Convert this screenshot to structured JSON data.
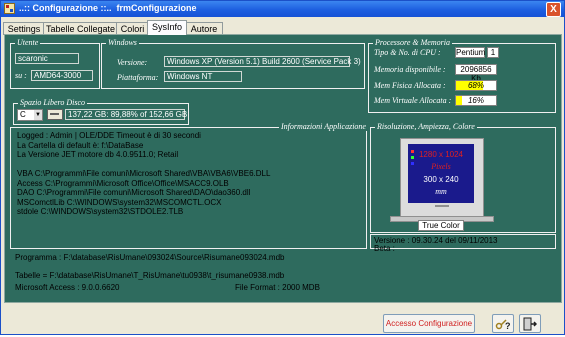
{
  "window": {
    "title": "..:: Configurazione ::..  frmConfigurazione",
    "close_label": "X"
  },
  "tabs": [
    "Settings",
    "Tabelle Collegate",
    "Colori",
    "SysInfo",
    "Autore"
  ],
  "utente": {
    "group_label": "Utente",
    "user": "scaronic",
    "su_label": "su :",
    "machine": "AMD64-3000"
  },
  "windows": {
    "group_label": "Windows",
    "version_label": "Versione:",
    "version": "Windows XP (Version 5.1) Build 2600 (Service Pack 3)",
    "platform_label": "Piattaforma:",
    "platform": "Windows NT"
  },
  "processore": {
    "group_label": "Processore & Memoria",
    "cpu_label": "Tipo  & No. di CPU :",
    "cpu_type": "Pentium",
    "cpu_count": "1",
    "mem_label": "Memoria disponibile :",
    "mem_value": "2096856 Kb",
    "phys_label": "Mem Fisica Allocata :",
    "phys_value": "68%",
    "phys_fraction": 0.68,
    "virt_label": "Mem Virtuale Allocata :",
    "virt_value": "16%",
    "virt_fraction": 0.16
  },
  "disco": {
    "group_label": "Spazio Libero Disco",
    "drive": "C",
    "info": "137,22 GB: 89,88% of 152,66 GB"
  },
  "app_info": {
    "group_label": "Informazioni Applicazione",
    "lines": [
      "Logged : Admin  |  OLE/DDE Timeout è di  30 secondi",
      "La Cartella di default è: f:\\DataBase",
      "La Versione JET motore db  4.0.9511.0; Retail",
      "",
      "VBA   C:\\Programmi\\File comuni\\Microsoft Shared\\VBA\\VBA6\\VBE6.DLL",
      "Access   C:\\Programmi\\Microsoft Office\\Office\\MSACC9.OLB",
      "DAO   C:\\Programmi\\File comuni\\Microsoft Shared\\DAO\\dao360.dll",
      "MSComctlLib    C:\\WINDOWS\\system32\\MSCOMCTL.OCX",
      "stdole   C:\\WINDOWS\\system32\\STDOLE2.TLB"
    ]
  },
  "risoluzione": {
    "group_label": "Risoluzione, Ampiezza, Colore",
    "resolution": "1280 x 1024",
    "unit1": "Pixels",
    "size": "300 x 240",
    "unit2": "mm",
    "color_label": "True Color"
  },
  "version_info": {
    "version": "Versione : 09.30.24 del 09/11/2013",
    "beta": "Beta :"
  },
  "paths": {
    "programma": "Programma : F:\\database\\RisUmane\\093024\\Source\\Risumane093024.mdb",
    "tabelle": "Tabelle  = F:\\database\\RisUmane\\T_RisUmane\\tu0938\\t_risumane0938.mdb",
    "access": "Microsoft Access   :  9.0.0.6620",
    "file_format": "File Format   : 2000 MDB"
  },
  "buttons": {
    "accesso": "Accesso Configurazione"
  },
  "colors": {
    "panel_bg": "#2e6b5e",
    "monitor_screen": "#1a1a8c",
    "resolution_text": "#e02020",
    "memory_bar": "#ffff00"
  }
}
